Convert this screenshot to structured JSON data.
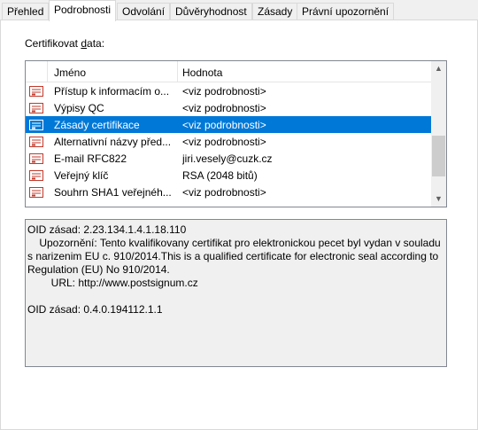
{
  "tabs": [
    {
      "label": "Přehled"
    },
    {
      "label": "Podrobnosti",
      "active": true
    },
    {
      "label": "Odvolání"
    },
    {
      "label": "Důvěryhodnost"
    },
    {
      "label": "Zásady"
    },
    {
      "label": "Právní upozornění"
    }
  ],
  "certificate_data": {
    "label_prefix": "Certifikovat ",
    "label_accel": "d",
    "label_suffix": "ata:"
  },
  "list": {
    "columns": {
      "name": "Jméno",
      "value": "Hodnota"
    },
    "rows": [
      {
        "name": "Přístup k informacím o...",
        "value": "<viz podrobnosti>",
        "icon": "certificate-field-icon"
      },
      {
        "name": "Výpisy QC",
        "value": "<viz podrobnosti>",
        "icon": "certificate-field-icon"
      },
      {
        "name": "Zásady certifikace",
        "value": "<viz podrobnosti>",
        "icon": "certificate-field-icon",
        "selected": true
      },
      {
        "name": "Alternativní názvy před...",
        "value": "<viz podrobnosti>",
        "icon": "certificate-field-icon"
      },
      {
        "name": "E-mail RFC822",
        "value": "jiri.vesely@cuzk.cz",
        "icon": "certificate-field-icon"
      },
      {
        "name": "Veřejný klíč",
        "value": "RSA (2048 bitů)",
        "icon": "certificate-field-icon"
      },
      {
        "name": "Souhrn SHA1 veřejnéh...",
        "value": "<viz podrobnosti>",
        "icon": "certificate-field-icon"
      }
    ]
  },
  "details_text": "OID zásad: 2.23.134.1.4.1.18.110\n    Upozornění: Tento kvalifikovany certifikat pro elektronickou pecet byl vydan v souladu s narizenim EU c. 910/2014.This is a qualified certificate for electronic seal according to Regulation (EU) No 910/2014.\n        URL: http://www.postsignum.cz\n\nOID zásad: 0.4.0.194112.1.1",
  "colors": {
    "selection": "#0078d7",
    "icon": "#c0392b"
  }
}
